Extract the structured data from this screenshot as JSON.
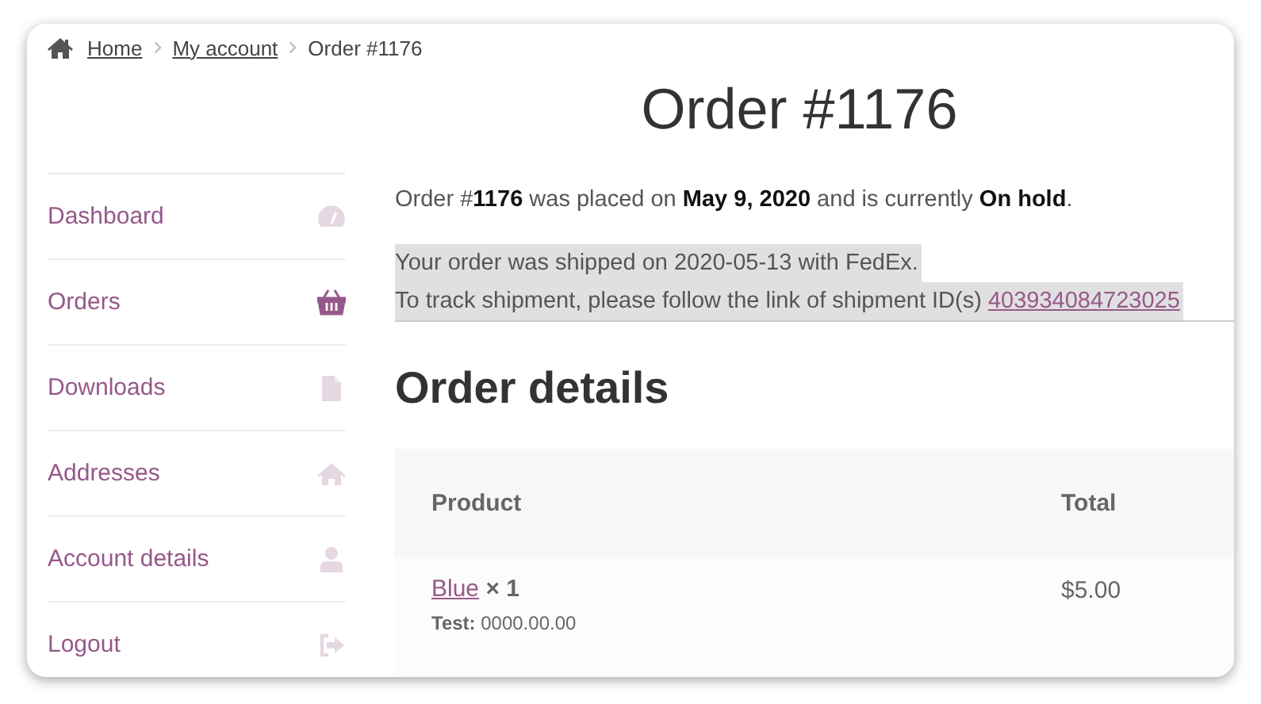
{
  "breadcrumb": [
    {
      "label": "Home",
      "kind": "link"
    },
    {
      "label": "My account",
      "kind": "link"
    },
    {
      "label": "Order #1176",
      "kind": "current"
    }
  ],
  "title": "Order #1176",
  "nav": [
    {
      "label": "Dashboard",
      "kind": "gauge",
      "selected": false
    },
    {
      "label": "Orders",
      "kind": "basket",
      "selected": true
    },
    {
      "label": "Downloads",
      "kind": "file",
      "selected": false
    },
    {
      "label": "Addresses",
      "kind": "house",
      "selected": false
    },
    {
      "label": "Account details",
      "kind": "person",
      "selected": false
    },
    {
      "label": "Logout",
      "kind": "exit",
      "selected": false
    }
  ],
  "summary": "Order #**1176** was placed on **May 9, 2020** and is currently **On hold**.",
  "shipping_notice": {
    "line_1": "Your order was shipped on 2020-05-13 with FedEx.",
    "line_2": "To track shipment, please follow the link of shipment ID(s)",
    "tracking_link": "403934084723025"
  },
  "details_heading": "Order details",
  "table": {
    "columns": [
      "Product",
      "Total"
    ],
    "rows": [
      {
        "product": "Blue",
        "quantity": "× 1",
        "meta_label": "Test:",
        "meta_value": "0000.00.00",
        "total": "$5.00"
      }
    ]
  }
}
